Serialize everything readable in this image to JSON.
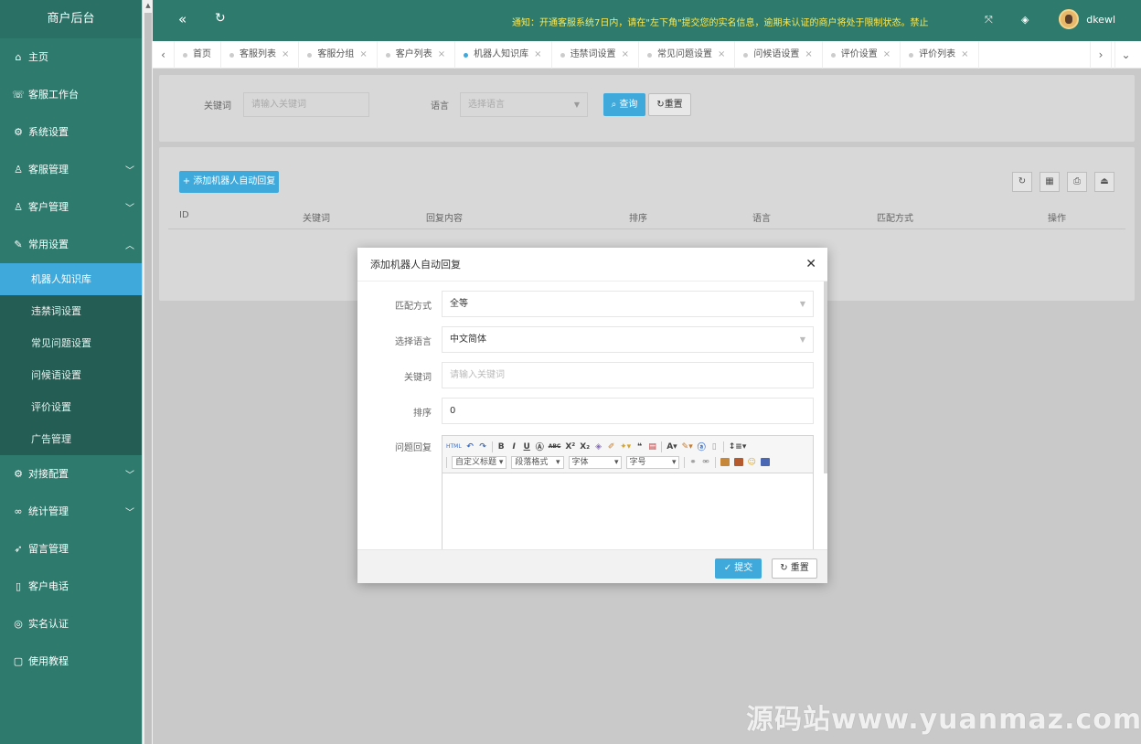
{
  "sidebar": {
    "title": "商户后台",
    "items": [
      {
        "label": "主页",
        "icon": "home-icon",
        "glyph": "⌂"
      },
      {
        "label": "客服工作台",
        "icon": "headset-icon",
        "glyph": "☏"
      },
      {
        "label": "系统设置",
        "icon": "gear-icon",
        "glyph": "⚙"
      },
      {
        "label": "客服管理",
        "icon": "user-icon",
        "glyph": "♙"
      },
      {
        "label": "客户管理",
        "icon": "users-icon",
        "glyph": "♙"
      },
      {
        "label": "常用设置",
        "icon": "edit-icon",
        "glyph": "✎"
      }
    ],
    "sub_items": [
      "机器人知识库",
      "违禁词设置",
      "常见问题设置",
      "问候语设置",
      "评价设置",
      "广告管理"
    ],
    "items_after": [
      {
        "label": "对接配置",
        "icon": "config-icon",
        "glyph": "⚙"
      },
      {
        "label": "统计管理",
        "icon": "chart-icon",
        "glyph": "∞"
      },
      {
        "label": "留言管理",
        "icon": "send-icon",
        "glyph": "➶"
      },
      {
        "label": "客户电话",
        "icon": "phone-icon",
        "glyph": "▯"
      },
      {
        "label": "实名认证",
        "icon": "shield-icon",
        "glyph": "◎"
      },
      {
        "label": "使用教程",
        "icon": "book-icon",
        "glyph": "▢"
      }
    ]
  },
  "header": {
    "collapse_glyph": "«",
    "refresh_glyph": "↻",
    "notice": "通知：开通客服系统7日内，请在\"左下角\"提交您的实名信息，逾期未认证的商户将处于限制状态。禁止",
    "fullscreen_glyph": "⤧",
    "layers_glyph": "◈",
    "username": "dkewl"
  },
  "tabs": {
    "prev_glyph": "‹",
    "next_glyph": "›",
    "more_glyph": "⌄",
    "close_glyph": "×",
    "items": [
      "首页",
      "客服列表",
      "客服分组",
      "客户列表",
      "机器人知识库",
      "违禁词设置",
      "常见问题设置",
      "问候语设置",
      "评价设置",
      "评价列表"
    ]
  },
  "search": {
    "keyword_label": "关键词",
    "keyword_placeholder": "请输入关键词",
    "lang_label": "语言",
    "lang_placeholder": "选择语言",
    "query_label": "查询",
    "reset_label": "重置"
  },
  "list": {
    "add_label": "+ 添加机器人自动回复",
    "columns": [
      "ID",
      "关键词",
      "回复内容",
      "排序",
      "语言",
      "匹配方式",
      "操作"
    ]
  },
  "modal": {
    "title": "添加机器人自动回复",
    "close_glyph": "✕",
    "match_label": "匹配方式",
    "match_value": "全等",
    "lang_label": "选择语言",
    "lang_value": "中文简体",
    "keyword_label": "关键词",
    "keyword_placeholder": "请输入关键词",
    "sort_label": "排序",
    "sort_value": "0",
    "reply_label": "问题回复",
    "editor": {
      "heading_select": "自定义标题",
      "para_select": "段落格式",
      "font_select": "字体",
      "size_select": "字号"
    },
    "submit_label": "✓ 提交",
    "reset_label": "↻ 重置"
  },
  "watermark": "源码站www.yuanmaz.com",
  "colors": {
    "sidebar": "#2e7b6e",
    "primary": "#3fa9dc",
    "notice": "#ffe84d"
  }
}
